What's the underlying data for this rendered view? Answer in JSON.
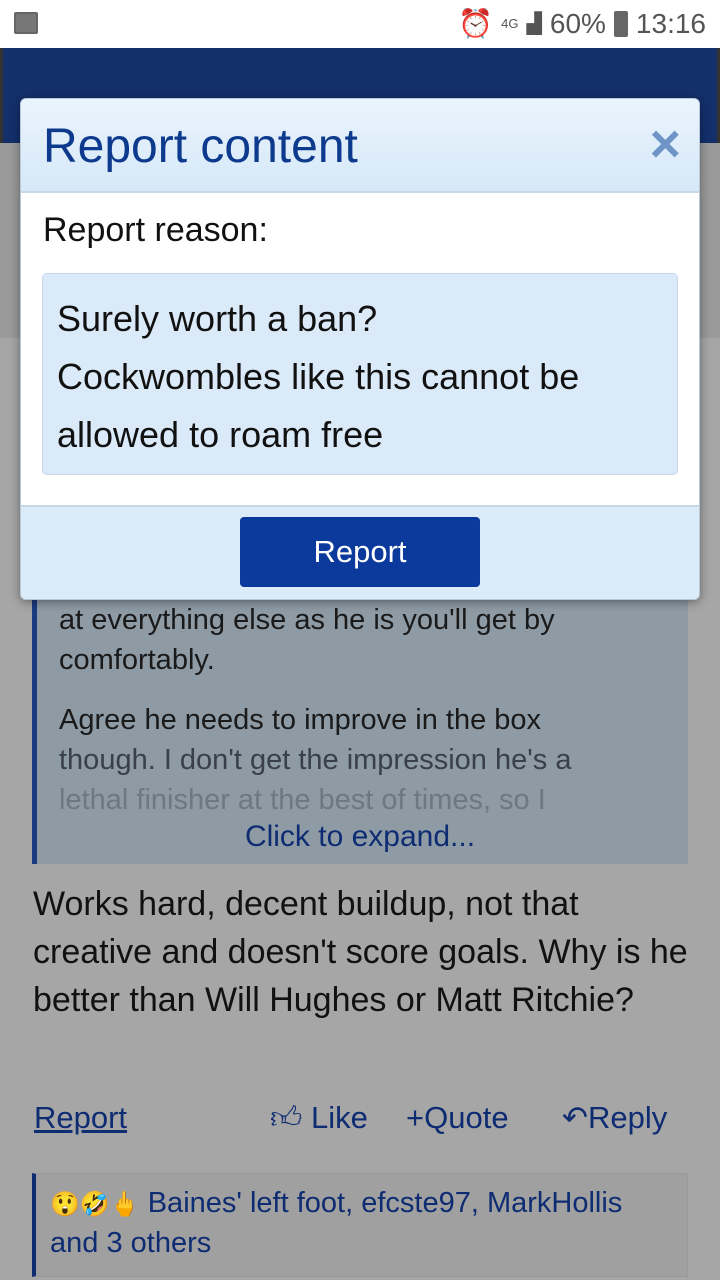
{
  "status_bar": {
    "network": "4G",
    "battery": "60%",
    "time": "13:16"
  },
  "quote": {
    "line_cut": "at everything else as he is you'll get by",
    "line1": "comfortably.",
    "line2": "Agree he needs to improve in the box",
    "line3": "though. I don't get the impression he's a",
    "line4": "lethal finisher at the best of times, so I",
    "expand": "Click to expand..."
  },
  "post": {
    "body": "Works hard, decent buildup, not that creative and doesn't score goals. Why is he better than Will Hughes or Matt Ritchie?"
  },
  "actions": {
    "report": "Report",
    "like": "Like",
    "quote": "Quote",
    "reply": "Reply"
  },
  "reactions": {
    "emojis": "😲🤣🖕",
    "text": "Baines' left foot, efcste97, MarkHollis and 3 others"
  },
  "modal": {
    "title": "Report content",
    "close": "×",
    "reason_label": "Report reason:",
    "reason_value": "Surely worth a ban?\nCockwombles like this cannot be allowed to roam free",
    "submit": "Report"
  },
  "colors": {
    "accent": "#0c3a9c",
    "header": "#14306b"
  }
}
